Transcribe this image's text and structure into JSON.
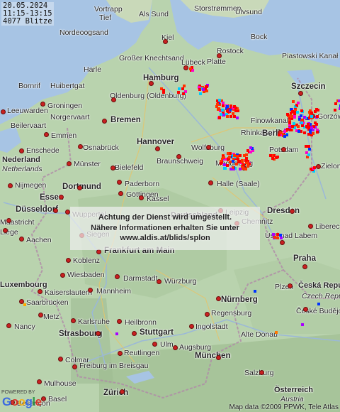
{
  "stamp": {
    "date": "20.05.2024",
    "time_range": "11:15-13:15",
    "count": "4077 Blitze"
  },
  "notice": {
    "line1": "Achtung der Dienst wird umgestellt.",
    "line2": "Nähere Informationen erhalten Sie unter",
    "line3": "www.aldis.at/blids/splon"
  },
  "map": {
    "land_color": "#b9d3ae",
    "sea_color": "#a7c4e4",
    "cities": [
      {
        "name": "Vortrapp",
        "style": "normal",
        "dot": false
      },
      {
        "name": "Tief",
        "style": "normal",
        "dot": false
      },
      {
        "name": "Als Sund",
        "style": "normal",
        "dot": false
      },
      {
        "name": "Storstrømmen",
        "style": "normal",
        "dot": false
      },
      {
        "name": "Ulvsund",
        "style": "normal",
        "dot": false
      },
      {
        "name": "Nordeoogsand",
        "style": "normal",
        "dot": false
      },
      {
        "name": "Kiel",
        "style": "normal",
        "dot": true
      },
      {
        "name": "Bock",
        "style": "normal",
        "dot": false
      },
      {
        "name": "Rostock",
        "style": "normal",
        "dot": true
      },
      {
        "name": "Großer Knechtsand",
        "style": "normal",
        "dot": false
      },
      {
        "name": "Lübeck",
        "style": "normal",
        "dot": true
      },
      {
        "name": "Platte",
        "style": "normal",
        "dot": false
      },
      {
        "name": "Harle",
        "style": "normal",
        "dot": false
      },
      {
        "name": "Hamburg",
        "style": "big",
        "dot": true
      },
      {
        "name": "Piastowski Kanał",
        "style": "normal",
        "dot": false
      },
      {
        "name": "Bornrif",
        "style": "normal",
        "dot": false
      },
      {
        "name": "Huibertgat",
        "style": "normal",
        "dot": false
      },
      {
        "name": "Oldenburg (Oldenburg)",
        "style": "normal",
        "dot": true
      },
      {
        "name": "Szczecin",
        "style": "big",
        "dot": true
      },
      {
        "name": "Leeuwarden",
        "style": "normal",
        "dot": true
      },
      {
        "name": "Groningen",
        "style": "normal",
        "dot": true
      },
      {
        "name": "Norgervaart",
        "style": "normal",
        "dot": false
      },
      {
        "name": "Bremen",
        "style": "big",
        "dot": true
      },
      {
        "name": "Finowkanal",
        "style": "normal",
        "dot": false
      },
      {
        "name": "Gorzów Wielkopolski",
        "style": "normal",
        "dot": true
      },
      {
        "name": "Beilervaart",
        "style": "normal",
        "dot": false
      },
      {
        "name": "Emmen",
        "style": "normal",
        "dot": true
      },
      {
        "name": "Rhinkanal",
        "style": "normal",
        "dot": false
      },
      {
        "name": "Berlin",
        "style": "big",
        "dot": true
      },
      {
        "name": "Hannover",
        "style": "big",
        "dot": true
      },
      {
        "name": "Potsdam",
        "style": "normal",
        "dot": true
      },
      {
        "name": "Wolfsburg",
        "style": "normal",
        "dot": true
      },
      {
        "name": "Enschede",
        "style": "normal",
        "dot": true
      },
      {
        "name": "Osnabrück",
        "style": "normal",
        "dot": true
      },
      {
        "name": "Nederland",
        "style": "bold",
        "dot": false
      },
      {
        "name": "Netherlands",
        "style": "italic",
        "dot": false
      },
      {
        "name": "Braunschweig",
        "style": "normal",
        "dot": true
      },
      {
        "name": "Magdeburg",
        "style": "normal",
        "dot": true
      },
      {
        "name": "Münster",
        "style": "normal",
        "dot": true
      },
      {
        "name": "Bielefeld",
        "style": "normal",
        "dot": true
      },
      {
        "name": "Zielona",
        "style": "normal",
        "dot": true
      },
      {
        "name": "Nijmegen",
        "style": "normal",
        "dot": true
      },
      {
        "name": "Paderborn",
        "style": "normal",
        "dot": true
      },
      {
        "name": "Dortmund",
        "style": "big",
        "dot": true
      },
      {
        "name": "Halle (Saale)",
        "style": "normal",
        "dot": true
      },
      {
        "name": "Göttingen",
        "style": "normal",
        "dot": true
      },
      {
        "name": "Essen",
        "style": "big",
        "dot": true
      },
      {
        "name": "Kassel",
        "style": "normal",
        "dot": true
      },
      {
        "name": "Leipzig",
        "style": "normal",
        "dot": true
      },
      {
        "name": "Düsseldorf",
        "style": "big",
        "dot": true
      },
      {
        "name": "Wuppertal",
        "style": "normal",
        "dot": true
      },
      {
        "name": "Deutschland",
        "style": "bold",
        "dot": false
      },
      {
        "name": "Dresden",
        "style": "big",
        "dot": true
      },
      {
        "name": "Maastricht",
        "style": "normal",
        "dot": true
      },
      {
        "name": "Chemnitz",
        "style": "normal",
        "dot": true
      },
      {
        "name": "Siegen",
        "style": "normal",
        "dot": true
      },
      {
        "name": "Liberec",
        "style": "normal",
        "dot": true
      },
      {
        "name": "Liège",
        "style": "normal",
        "dot": true
      },
      {
        "name": "Aachen",
        "style": "normal",
        "dot": true
      },
      {
        "name": "Ústí nad Labem",
        "style": "normal",
        "dot": true
      },
      {
        "name": "Frankfurt am Main",
        "style": "big",
        "dot": true
      },
      {
        "name": "Koblenz",
        "style": "normal",
        "dot": true
      },
      {
        "name": "Wiesbaden",
        "style": "normal",
        "dot": true
      },
      {
        "name": "Praha",
        "style": "big",
        "dot": true
      },
      {
        "name": "Darmstadt",
        "style": "normal",
        "dot": true
      },
      {
        "name": "Würzburg",
        "style": "normal",
        "dot": true
      },
      {
        "name": "Luxembourg",
        "style": "bold",
        "dot": false
      },
      {
        "name": "Kaiserslautern",
        "style": "normal",
        "dot": true
      },
      {
        "name": "Mannheim",
        "style": "normal",
        "dot": true
      },
      {
        "name": "Plzeň",
        "style": "normal",
        "dot": true
      },
      {
        "name": "Česká Republika",
        "style": "bold",
        "dot": false
      },
      {
        "name": "Czech Republic",
        "style": "italic",
        "dot": false
      },
      {
        "name": "Saarbrücken",
        "style": "normal",
        "dot": true
      },
      {
        "name": "Nürnberg",
        "style": "big",
        "dot": true
      },
      {
        "name": "Metz",
        "style": "normal",
        "dot": true
      },
      {
        "name": "Karlsruhe",
        "style": "normal",
        "dot": true
      },
      {
        "name": "Regensburg",
        "style": "normal",
        "dot": true
      },
      {
        "name": "Heilbronn",
        "style": "normal",
        "dot": true
      },
      {
        "name": "České Budějovice",
        "style": "normal",
        "dot": true
      },
      {
        "name": "Nancy",
        "style": "normal",
        "dot": true
      },
      {
        "name": "Ingolstadt",
        "style": "normal",
        "dot": true
      },
      {
        "name": "Strasbourg",
        "style": "big",
        "dot": true
      },
      {
        "name": "Stuttgart",
        "style": "big",
        "dot": true
      },
      {
        "name": "Alte Donau",
        "style": "normal",
        "dot": false
      },
      {
        "name": "Ulm",
        "style": "normal",
        "dot": true
      },
      {
        "name": "Augsburg",
        "style": "normal",
        "dot": true
      },
      {
        "name": "Reutlingen",
        "style": "normal",
        "dot": true
      },
      {
        "name": "Colmar",
        "style": "normal",
        "dot": true
      },
      {
        "name": "Freiburg im Breisgau",
        "style": "normal",
        "dot": true
      },
      {
        "name": "München",
        "style": "big",
        "dot": true
      },
      {
        "name": "Salzburg",
        "style": "normal",
        "dot": true
      },
      {
        "name": "Mulhouse",
        "style": "normal",
        "dot": true
      },
      {
        "name": "Zürich",
        "style": "big",
        "dot": true
      },
      {
        "name": "Basel",
        "style": "normal",
        "dot": true
      },
      {
        "name": "Besançon",
        "style": "normal",
        "dot": true
      },
      {
        "name": "Österreich",
        "style": "bold",
        "dot": false
      },
      {
        "name": "Austria",
        "style": "italic",
        "dot": false
      }
    ]
  },
  "attribution": {
    "powered_by": "POWERED BY",
    "logo": "Google",
    "copyright": "Map data ©2009 PPWK, Tele Atlas"
  },
  "strike_colors": [
    "#ff0000",
    "#ff3300",
    "#ff7700",
    "#ffaa00",
    "#ffee00",
    "#66ff00",
    "#00ccff",
    "#0033ff",
    "#aa00ff",
    "#ff00cc"
  ]
}
